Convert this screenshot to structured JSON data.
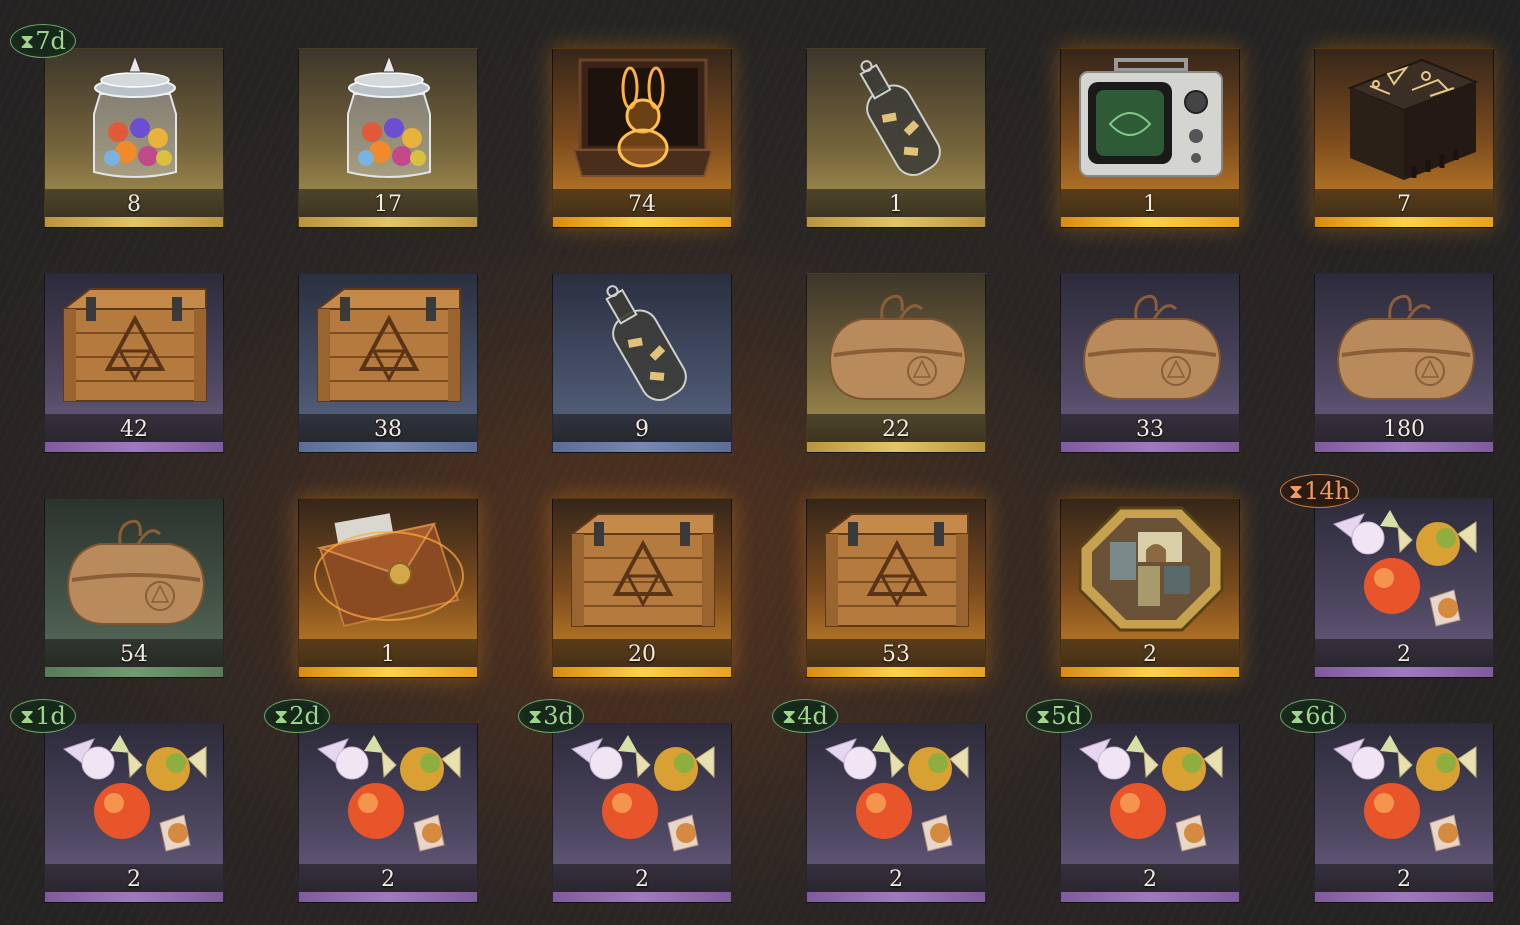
{
  "inventory": {
    "items": [
      {
        "name": "jar-of-marbles",
        "count": "8",
        "rarity": "gold",
        "timer": "7d",
        "timer_color": "green"
      },
      {
        "name": "jar-of-marbles",
        "count": "17",
        "rarity": "gold",
        "timer": "",
        "timer_color": ""
      },
      {
        "name": "glowing-rabbit-box",
        "count": "74",
        "rarity": "orange",
        "timer": "",
        "timer_color": ""
      },
      {
        "name": "bottle-with-notes",
        "count": "1",
        "rarity": "gold",
        "timer": "",
        "timer_color": ""
      },
      {
        "name": "radio-monitor",
        "count": "1",
        "rarity": "orange",
        "timer": "",
        "timer_color": ""
      },
      {
        "name": "rune-wooden-block",
        "count": "7",
        "rarity": "orange",
        "timer": "",
        "timer_color": ""
      },
      {
        "name": "wooden-crate",
        "count": "42",
        "rarity": "purple",
        "timer": "",
        "timer_color": ""
      },
      {
        "name": "wooden-crate",
        "count": "38",
        "rarity": "blue",
        "timer": "",
        "timer_color": ""
      },
      {
        "name": "bottle-with-notes",
        "count": "9",
        "rarity": "blue",
        "timer": "",
        "timer_color": ""
      },
      {
        "name": "paper-parcel",
        "count": "22",
        "rarity": "gold",
        "timer": "",
        "timer_color": ""
      },
      {
        "name": "paper-parcel",
        "count": "33",
        "rarity": "purple",
        "timer": "",
        "timer_color": ""
      },
      {
        "name": "paper-parcel",
        "count": "180",
        "rarity": "purple",
        "timer": "",
        "timer_color": ""
      },
      {
        "name": "paper-parcel",
        "count": "54",
        "rarity": "green",
        "timer": "",
        "timer_color": ""
      },
      {
        "name": "sealed-envelope",
        "count": "1",
        "rarity": "orange",
        "timer": "",
        "timer_color": ""
      },
      {
        "name": "wooden-crate",
        "count": "20",
        "rarity": "orange",
        "timer": "",
        "timer_color": ""
      },
      {
        "name": "wooden-crate",
        "count": "53",
        "rarity": "orange",
        "timer": "",
        "timer_color": ""
      },
      {
        "name": "puzzle-box",
        "count": "2",
        "rarity": "orange",
        "timer": "",
        "timer_color": ""
      },
      {
        "name": "candies",
        "count": "2",
        "rarity": "purple",
        "timer": "14h",
        "timer_color": "orange"
      },
      {
        "name": "candies",
        "count": "2",
        "rarity": "purple",
        "timer": "1d",
        "timer_color": "green"
      },
      {
        "name": "candies",
        "count": "2",
        "rarity": "purple",
        "timer": "2d",
        "timer_color": "green"
      },
      {
        "name": "candies",
        "count": "2",
        "rarity": "purple",
        "timer": "3d",
        "timer_color": "green"
      },
      {
        "name": "candies",
        "count": "2",
        "rarity": "purple",
        "timer": "4d",
        "timer_color": "green"
      },
      {
        "name": "candies",
        "count": "2",
        "rarity": "purple",
        "timer": "5d",
        "timer_color": "green"
      },
      {
        "name": "candies",
        "count": "2",
        "rarity": "purple",
        "timer": "6d",
        "timer_color": "green"
      }
    ]
  }
}
